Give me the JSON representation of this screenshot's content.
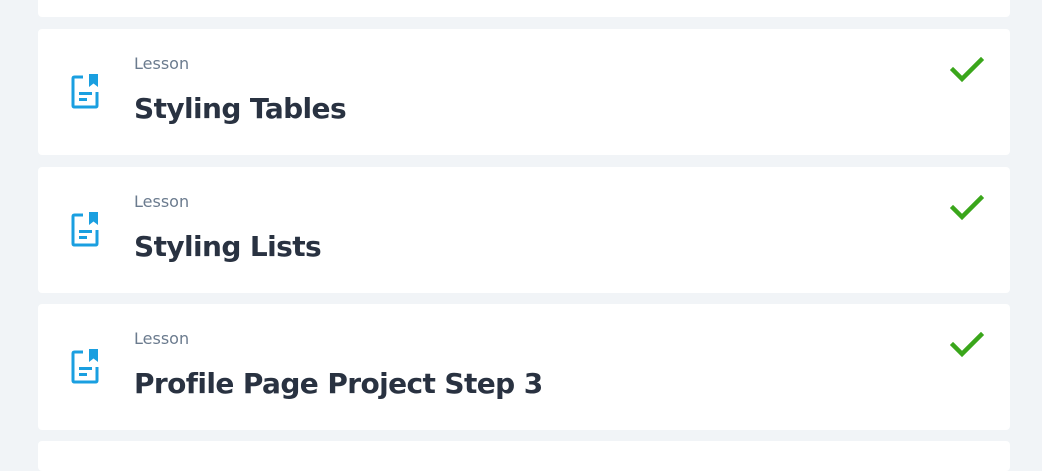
{
  "lessons": [
    {
      "type": "Lesson",
      "title": "Styling Tables",
      "completed": true,
      "icon": "lesson-document-icon",
      "status_icon": "check-icon"
    },
    {
      "type": "Lesson",
      "title": "Styling Lists",
      "completed": true,
      "icon": "lesson-document-icon",
      "status_icon": "check-icon"
    },
    {
      "type": "Lesson",
      "title": "Profile Page Project Step 3",
      "completed": true,
      "icon": "lesson-document-icon",
      "status_icon": "check-icon"
    }
  ],
  "colors": {
    "page_background": "#f1f4f7",
    "card_background": "#ffffff",
    "icon_accent": "#1a9fe0",
    "check_accent": "#3aa61b",
    "type_text": "#6b7b8e",
    "title_text": "#293241"
  }
}
